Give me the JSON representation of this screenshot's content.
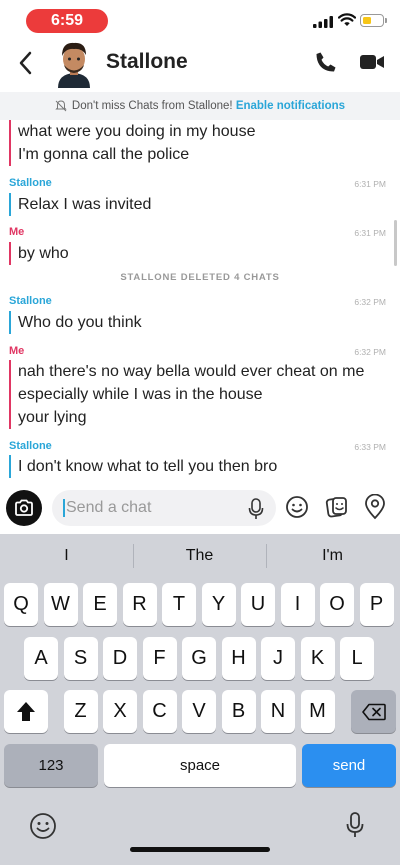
{
  "status_bar": {
    "time": "6:59"
  },
  "header": {
    "contact_name": "Stallone"
  },
  "banner": {
    "text": "Don't miss Chats from Stallone!",
    "link": "Enable notifications"
  },
  "messages": {
    "m0": {
      "lines": [
        "what were you doing in my house",
        "I'm gonna call the police"
      ]
    },
    "m1": {
      "sender": "Stallone",
      "time": "6:31 PM",
      "text": "Relax I was invited"
    },
    "m2": {
      "sender": "Me",
      "time": "6:31 PM",
      "text": "by who"
    },
    "note": "STALLONE DELETED 4 CHATS",
    "m3": {
      "sender": "Stallone",
      "time": "6:32 PM",
      "text": "Who do you think"
    },
    "m4": {
      "sender": "Me",
      "time": "6:32 PM",
      "lines": [
        "nah there's no way bella would ever cheat on me",
        "especially while I was in the house",
        "your lying"
      ]
    },
    "m5": {
      "sender": "Stallone",
      "time": "6:33 PM",
      "text": "I don't know what to tell you then bro"
    }
  },
  "input": {
    "placeholder": "Send a chat",
    "value": ""
  },
  "keyboard": {
    "predictions": [
      "I",
      "The",
      "I'm"
    ],
    "row1": [
      "Q",
      "W",
      "E",
      "R",
      "T",
      "Y",
      "U",
      "I",
      "O",
      "P"
    ],
    "row2": [
      "A",
      "S",
      "D",
      "F",
      "G",
      "H",
      "J",
      "K",
      "L"
    ],
    "row3": [
      "Z",
      "X",
      "C",
      "V",
      "B",
      "N",
      "M"
    ],
    "numbers_label": "123",
    "space_label": "space",
    "send_label": "send"
  },
  "colors": {
    "them": "#2aa6d8",
    "me": "#e03663",
    "send_key": "#2b8ff0",
    "time_pill": "#ec3b3b"
  }
}
